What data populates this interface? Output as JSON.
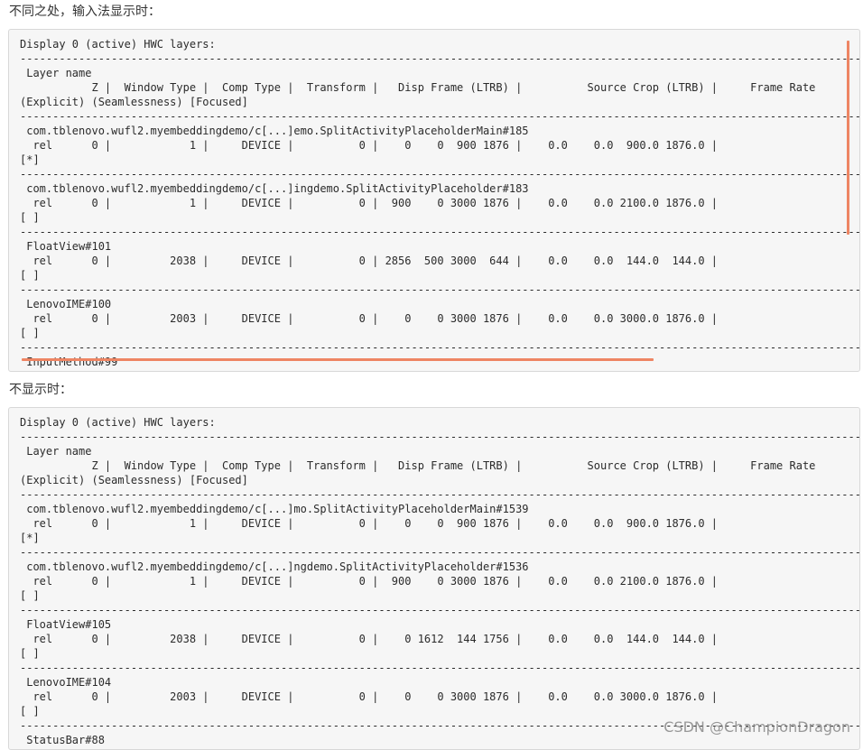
{
  "sections": [
    {
      "caption": "不同之处，输入法显示时：",
      "lines": [
        "Display 0 (active) HWC layers:",
        "-------------------------------------------------------------------------------------------------------------------------------------",
        " Layer name",
        "           Z |  Window Type |  Comp Type |  Transform |   Disp Frame (LTRB) |          Source Crop (LTRB) |     Frame Rate",
        "(Explicit) (Seamlessness) [Focused]",
        "-------------------------------------------------------------------------------------------------------------------------------------",
        " com.tblenovo.wufl2.myembeddingdemo/c[...]emo.SplitActivityPlaceholderMain#185",
        "  rel      0 |            1 |     DEVICE |          0 |    0    0  900 1876 |    0.0    0.0  900.0 1876.0 |",
        "[*]",
        "-------------------------------------------------------------------------------------------------------------------------------------",
        " com.tblenovo.wufl2.myembeddingdemo/c[...]ingdemo.SplitActivityPlaceholder#183",
        "  rel      0 |            1 |     DEVICE |          0 |  900    0 3000 1876 |    0.0    0.0 2100.0 1876.0 |",
        "[ ]",
        "-------------------------------------------------------------------------------------------------------------------------------------",
        " FloatView#101",
        "  rel      0 |         2038 |     DEVICE |          0 | 2856  500 3000  644 |    0.0    0.0  144.0  144.0 |",
        "[ ]",
        "-------------------------------------------------------------------------------------------------------------------------------------",
        " LenovoIME#100",
        "  rel      0 |         2003 |     DEVICE |          0 |    0    0 3000 1876 |    0.0    0.0 3000.0 1876.0 |",
        "[ ]",
        "-------------------------------------------------------------------------------------------------------------------------------------",
        " InputMethod#99"
      ]
    },
    {
      "caption": "不显示时：",
      "lines": [
        "Display 0 (active) HWC layers:",
        "-------------------------------------------------------------------------------------------------------------------------------------",
        " Layer name",
        "           Z |  Window Type |  Comp Type |  Transform |   Disp Frame (LTRB) |          Source Crop (LTRB) |     Frame Rate",
        "(Explicit) (Seamlessness) [Focused]",
        "-------------------------------------------------------------------------------------------------------------------------------------",
        " com.tblenovo.wufl2.myembeddingdemo/c[...]mo.SplitActivityPlaceholderMain#1539",
        "  rel      0 |            1 |     DEVICE |          0 |    0    0  900 1876 |    0.0    0.0  900.0 1876.0 |",
        "[*]",
        "-------------------------------------------------------------------------------------------------------------------------------------",
        " com.tblenovo.wufl2.myembeddingdemo/c[...]ngdemo.SplitActivityPlaceholder#1536",
        "  rel      0 |            1 |     DEVICE |          0 |  900    0 3000 1876 |    0.0    0.0 2100.0 1876.0 |",
        "[ ]",
        "-------------------------------------------------------------------------------------------------------------------------------------",
        " FloatView#105",
        "  rel      0 |         2038 |     DEVICE |          0 |    0 1612  144 1756 |    0.0    0.0  144.0  144.0 |",
        "[ ]",
        "-------------------------------------------------------------------------------------------------------------------------------------",
        " LenovoIME#104",
        "  rel      0 |         2003 |     DEVICE |          0 |    0    0 3000 1876 |    0.0    0.0 3000.0 1876.0 |",
        "[ ]",
        "-------------------------------------------------------------------------------------------------------------------------------------",
        " StatusBar#88"
      ]
    }
  ],
  "watermark": "CSDN @ChampionDragon",
  "colors": {
    "annotation": "#ee8563",
    "code_background": "#f6f6f6"
  }
}
